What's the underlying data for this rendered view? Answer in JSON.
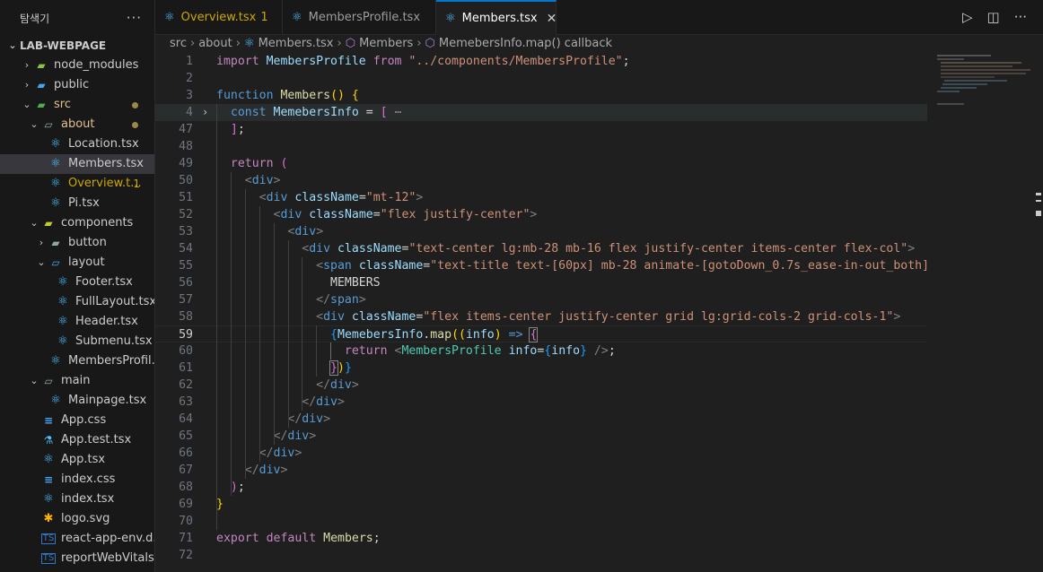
{
  "explorer": {
    "title": "탐색기",
    "more": "···",
    "project": "LAB-WEBPAGE",
    "items": [
      {
        "label": "node_modules",
        "chev": "›",
        "icon": "folder-node"
      },
      {
        "label": "public",
        "chev": "›",
        "icon": "folder-public"
      },
      {
        "label": "src",
        "chev": "⌄",
        "icon": "folder-src",
        "modified": true
      },
      {
        "label": "about",
        "chev": "⌄",
        "icon": "folder-open",
        "modified": true
      },
      {
        "label": "Location.tsx",
        "icon": "react-icon"
      },
      {
        "label": "Members.tsx",
        "icon": "react-icon",
        "selected": true
      },
      {
        "label": "Overview.t...",
        "icon": "react-icon",
        "badge": "1"
      },
      {
        "label": "Pi.tsx",
        "icon": "react-icon"
      },
      {
        "label": "components",
        "chev": "⌄",
        "icon": "folder-components"
      },
      {
        "label": "button",
        "chev": "›",
        "icon": "folder"
      },
      {
        "label": "layout",
        "chev": "⌄",
        "icon": "folder-layout"
      },
      {
        "label": "Footer.tsx",
        "icon": "react-icon"
      },
      {
        "label": "FullLayout.tsx",
        "icon": "react-icon"
      },
      {
        "label": "Header.tsx",
        "icon": "react-icon"
      },
      {
        "label": "Submenu.tsx",
        "icon": "react-icon"
      },
      {
        "label": "MembersProfil...",
        "icon": "react-icon"
      },
      {
        "label": "main",
        "chev": "⌄",
        "icon": "folder-open"
      },
      {
        "label": "Mainpage.tsx",
        "icon": "react-icon"
      },
      {
        "label": "App.css",
        "icon": "css-icon"
      },
      {
        "label": "App.test.tsx",
        "icon": "test-icon"
      },
      {
        "label": "App.tsx",
        "icon": "react-icon"
      },
      {
        "label": "index.css",
        "icon": "css-icon"
      },
      {
        "label": "index.tsx",
        "icon": "react-icon"
      },
      {
        "label": "logo.svg",
        "icon": "svg-icon"
      },
      {
        "label": "react-app-env.d.ts",
        "icon": "ts-icon"
      },
      {
        "label": "reportWebVitals....",
        "icon": "ts-icon"
      }
    ]
  },
  "tabs": [
    {
      "label": "Overview.tsx",
      "badge": "1",
      "warn": true
    },
    {
      "label": "MembersProfile.tsx"
    },
    {
      "label": "Members.tsx",
      "active": true,
      "close": "✕"
    }
  ],
  "breadcrumb": [
    "src",
    "about",
    "Members.tsx",
    "Members",
    "MemebersInfo.map() callback"
  ],
  "colors": {
    "accent": "#0078d4",
    "warning": "#cca700",
    "modified": "#e2c08d",
    "react": "#4fc1ff"
  },
  "code": [
    {
      "n": "1",
      "html": "<span class='k'>import</span> <span class='v'>MembersProfile</span> <span class='k'>from</span> <span class='s'>\"../components/MembersProfile\"</span><span class='w'>;</span>"
    },
    {
      "n": "2",
      "html": ""
    },
    {
      "n": "3",
      "html": "<span class='kb'>function</span> <span class='f'>Members</span><span class='p1'>()</span> <span class='p1'>{</span>"
    },
    {
      "n": "4",
      "html": "  <span class='kb'>const</span> <span class='v'>MemebersInfo</span> <span class='w'>=</span> <span class='p2'>[</span> <span class='dots'>⋯</span>",
      "fold": "›",
      "hl": true
    },
    {
      "n": "47",
      "html": "  <span class='p2'>]</span><span class='w'>;</span>"
    },
    {
      "n": "48",
      "html": ""
    },
    {
      "n": "49",
      "html": "  <span class='k'>return</span> <span class='p2'>(</span>"
    },
    {
      "n": "50",
      "html": "    <span class='tg'>&lt;</span><span class='t'>div</span><span class='tg'>&gt;</span>"
    },
    {
      "n": "51",
      "html": "      <span class='tg'>&lt;</span><span class='t'>div</span> <span class='a'>className</span><span class='w'>=</span><span class='s'>\"mt-12\"</span><span class='tg'>&gt;</span>"
    },
    {
      "n": "52",
      "html": "        <span class='tg'>&lt;</span><span class='t'>div</span> <span class='a'>className</span><span class='w'>=</span><span class='s'>\"flex justify-center\"</span><span class='tg'>&gt;</span>"
    },
    {
      "n": "53",
      "html": "          <span class='tg'>&lt;</span><span class='t'>div</span><span class='tg'>&gt;</span>"
    },
    {
      "n": "54",
      "html": "            <span class='tg'>&lt;</span><span class='t'>div</span> <span class='a'>className</span><span class='w'>=</span><span class='s'>\"text-center lg:mb-28 mb-16 flex justify-center items-center flex-col\"</span><span class='tg'>&gt;</span>"
    },
    {
      "n": "55",
      "html": "              <span class='tg'>&lt;</span><span class='t'>span</span> <span class='a'>className</span><span class='w'>=</span><span class='s'>\"text-title text-[60px] mb-28 animate-[gotoDown_0.7s_ease-in-out_both]\"</span><span class='tg'>&gt;</span>"
    },
    {
      "n": "56",
      "html": "                <span class='w'>MEMBERS</span>"
    },
    {
      "n": "57",
      "html": "              <span class='tg'>&lt;/</span><span class='t'>span</span><span class='tg'>&gt;</span>"
    },
    {
      "n": "58",
      "html": "              <span class='tg'>&lt;</span><span class='t'>div</span> <span class='a'>className</span><span class='w'>=</span><span class='s'>\"flex items-center justify-center grid lg:grid-cols-2 grid-cols-1\"</span><span class='tg'>&gt;</span>"
    },
    {
      "n": "59",
      "html": "                <span class='p3'>{</span><span class='v'>MemebersInfo</span><span class='w'>.</span><span class='f'>map</span><span class='p1'>((</span><span class='v'>info</span><span class='p1'>)</span> <span class='kb'>=&gt;</span> <span class='p2' style='outline:1px solid #888'>{</span>",
      "cur": true
    },
    {
      "n": "60",
      "html": "                  <span class='k'>return</span> <span class='tg'>&lt;</span><span class='c'>MembersProfile</span> <span class='a'>info</span><span class='w'>=</span><span class='p3'>{</span><span class='v'>info</span><span class='p3'>}</span> <span class='tg'>/&gt;</span><span class='w'>;</span>"
    },
    {
      "n": "61",
      "html": "                <span class='p2' style='outline:1px solid #888'>}</span><span class='p1'>)</span><span class='p3'>}</span>"
    },
    {
      "n": "62",
      "html": "              <span class='tg'>&lt;/</span><span class='t'>div</span><span class='tg'>&gt;</span>"
    },
    {
      "n": "63",
      "html": "            <span class='tg'>&lt;/</span><span class='t'>div</span><span class='tg'>&gt;</span>"
    },
    {
      "n": "64",
      "html": "          <span class='tg'>&lt;/</span><span class='t'>div</span><span class='tg'>&gt;</span>"
    },
    {
      "n": "65",
      "html": "        <span class='tg'>&lt;/</span><span class='t'>div</span><span class='tg'>&gt;</span>"
    },
    {
      "n": "66",
      "html": "      <span class='tg'>&lt;/</span><span class='t'>div</span><span class='tg'>&gt;</span>"
    },
    {
      "n": "67",
      "html": "    <span class='tg'>&lt;/</span><span class='t'>div</span><span class='tg'>&gt;</span>"
    },
    {
      "n": "68",
      "html": "  <span class='p2'>)</span><span class='w'>;</span>"
    },
    {
      "n": "69",
      "html": "<span class='p1'>}</span>"
    },
    {
      "n": "70",
      "html": ""
    },
    {
      "n": "71",
      "html": "<span class='k'>export</span> <span class='k'>default</span> <span class='f'>Members</span><span class='w'>;</span>"
    },
    {
      "n": "72",
      "html": ""
    }
  ]
}
